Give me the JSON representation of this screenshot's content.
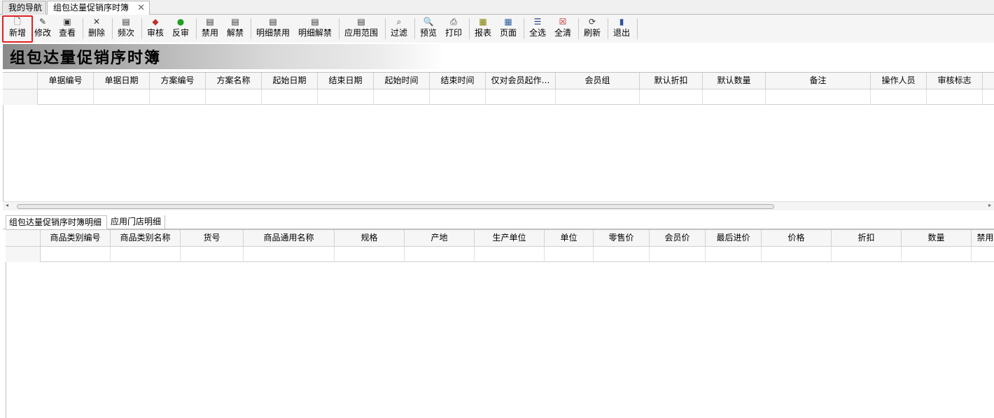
{
  "tabs": [
    {
      "label": "我的导航"
    },
    {
      "label": "组包达量促销序时簿",
      "close": "✕"
    }
  ],
  "toolbar": [
    {
      "label": "新增",
      "icon": "new-doc-icon"
    },
    {
      "label": "修改",
      "icon": "edit-icon"
    },
    {
      "label": "查看",
      "icon": "view-icon"
    },
    {
      "label": "删除",
      "icon": "delete-x-icon"
    },
    {
      "label": "频次",
      "icon": "list-icon"
    },
    {
      "label": "审核",
      "icon": "audit-icon"
    },
    {
      "label": "反审",
      "icon": "unaudit-icon"
    },
    {
      "label": "禁用",
      "icon": "list-icon"
    },
    {
      "label": "解禁",
      "icon": "list-icon"
    },
    {
      "label": "明细禁用",
      "icon": "list-icon"
    },
    {
      "label": "明细解禁",
      "icon": "list-icon"
    },
    {
      "label": "应用范围",
      "icon": "list-icon"
    },
    {
      "label": "过滤",
      "icon": "binoculars-icon"
    },
    {
      "label": "预览",
      "icon": "preview-icon"
    },
    {
      "label": "打印",
      "icon": "printer-icon"
    },
    {
      "label": "报表",
      "icon": "report-icon"
    },
    {
      "label": "页面",
      "icon": "page-icon"
    },
    {
      "label": "全选",
      "icon": "select-all-icon"
    },
    {
      "label": "全清",
      "icon": "clear-all-icon"
    },
    {
      "label": "刷新",
      "icon": "refresh-icon"
    },
    {
      "label": "退出",
      "icon": "exit-icon"
    }
  ],
  "banner": {
    "title": "组包达量促销序时簿"
  },
  "master_grid": {
    "columns": [
      "单据编号",
      "单据日期",
      "方案编号",
      "方案名称",
      "起始日期",
      "结束日期",
      "起始时间",
      "结束时间",
      "仅对会员起作…",
      "会员组",
      "默认折扣",
      "默认数量",
      "备注",
      "操作人员",
      "审核标志"
    ]
  },
  "detail_tabs": [
    "组包达量促销序时簿明细",
    "应用门店明细"
  ],
  "detail_grid": {
    "columns": [
      "商品类别编号",
      "商品类别名称",
      "货号",
      "商品通用名称",
      "规格",
      "产地",
      "生产单位",
      "单位",
      "零售价",
      "会员价",
      "最后进价",
      "价格",
      "折扣",
      "数量",
      "禁用"
    ]
  },
  "colors": {
    "highlight": "#e02020"
  }
}
